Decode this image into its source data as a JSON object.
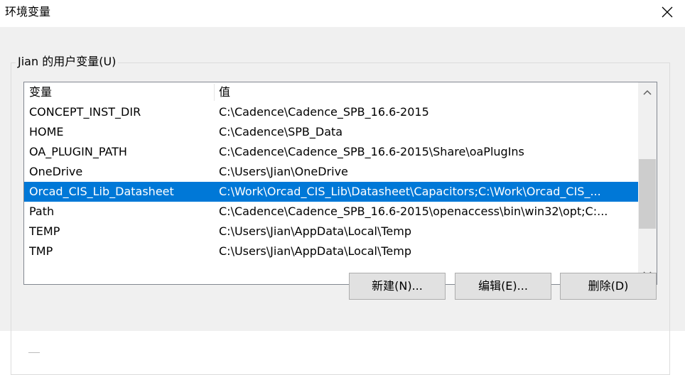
{
  "window": {
    "title": "环境变量",
    "close_icon": "close-icon"
  },
  "user_vars": {
    "group_label": "Jian 的用户变量(U)",
    "columns": {
      "name": "变量",
      "value": "值"
    },
    "rows": [
      {
        "name": "CONCEPT_INST_DIR",
        "value": "C:\\Cadence\\Cadence_SPB_16.6-2015"
      },
      {
        "name": "HOME",
        "value": "C:\\Cadence\\SPB_Data"
      },
      {
        "name": "OA_PLUGIN_PATH",
        "value": "C:\\Cadence\\Cadence_SPB_16.6-2015\\Share\\oaPlugIns"
      },
      {
        "name": "OneDrive",
        "value": "C:\\Users\\Jian\\OneDrive"
      },
      {
        "name": "Orcad_CIS_Lib_Datasheet",
        "value": "C:\\Work\\Orcad_CIS_Lib\\Datasheet\\Capacitors;C:\\Work\\Orcad_CIS_...",
        "selected": true
      },
      {
        "name": "Path",
        "value": "C:\\Cadence\\Cadence_SPB_16.6-2015\\openaccess\\bin\\win32\\opt;C:..."
      },
      {
        "name": "TEMP",
        "value": "C:\\Users\\Jian\\AppData\\Local\\Temp"
      },
      {
        "name": "TMP",
        "value": "C:\\Users\\Jian\\AppData\\Local\\Temp"
      }
    ],
    "buttons": {
      "new": "新建(N)...",
      "edit": "编辑(E)...",
      "delete": "删除(D)"
    }
  },
  "colors": {
    "selection": "#0078d7",
    "background": "#f0f0f0"
  }
}
